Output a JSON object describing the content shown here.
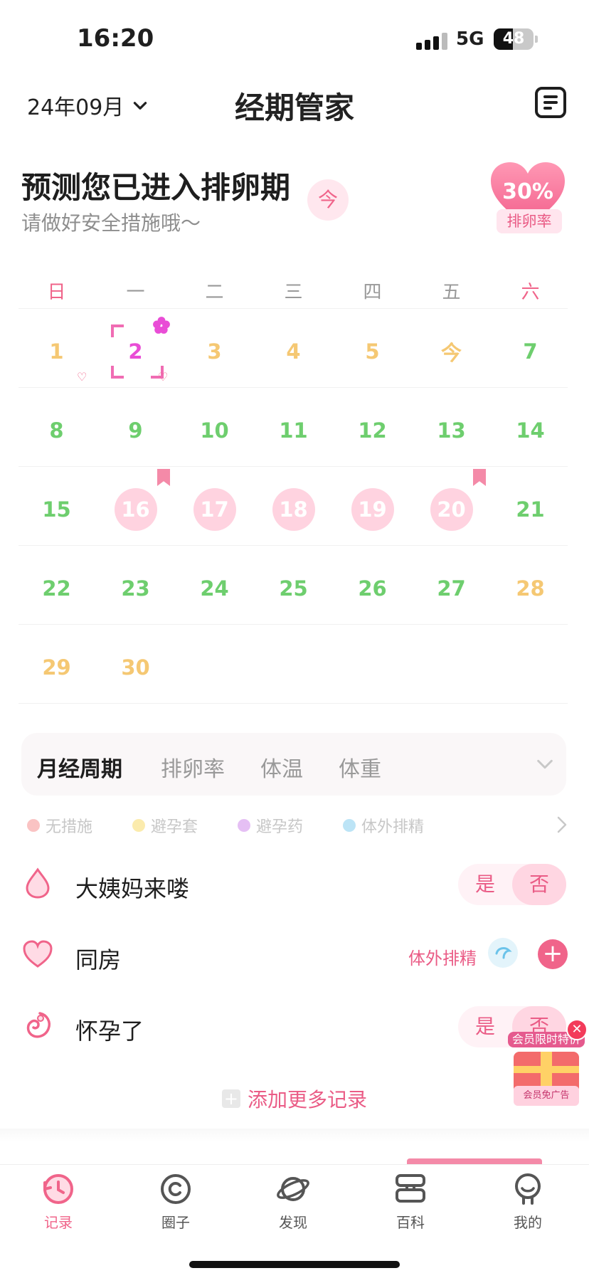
{
  "status_bar": {
    "time": "16:20",
    "network": "5G",
    "battery": "48",
    "battery_level": 0.48
  },
  "header": {
    "month": "24年09月",
    "title": "经期管家"
  },
  "prediction": {
    "title": "预测您已进入排卵期",
    "subtitle": "请做好安全措施哦～",
    "today_chip": "今",
    "ovulation_rate": "30%",
    "ovulation_rate_label": "排卵率"
  },
  "calendar": {
    "weekdays": [
      "日",
      "一",
      "二",
      "三",
      "四",
      "五",
      "六"
    ],
    "rows": [
      [
        "1",
        "2",
        "3",
        "4",
        "5",
        "今",
        "7"
      ],
      [
        "8",
        "9",
        "10",
        "11",
        "12",
        "13",
        "14"
      ],
      [
        "15",
        "16",
        "17",
        "18",
        "19",
        "20",
        "21"
      ],
      [
        "22",
        "23",
        "24",
        "25",
        "26",
        "27",
        "28"
      ],
      [
        "29",
        "30",
        "",
        "",
        "",
        "",
        ""
      ]
    ],
    "heart_marker": "♡"
  },
  "tabs": [
    "月经周期",
    "排卵率",
    "体温",
    "体重"
  ],
  "legend": [
    "无措施",
    "避孕套",
    "避孕药",
    "体外排精"
  ],
  "colors": {
    "accent": "#f0648a",
    "fertile_circle": "#ffd3e0",
    "safe_green": "#6ece6e",
    "period_yellow": "#f5c873",
    "legend_dots": [
      "#f47a7a",
      "#f7d34a",
      "#c572e6",
      "#6bc3ea"
    ]
  },
  "records": {
    "period": {
      "label": "大姨妈来喽",
      "yes": "是",
      "no": "否",
      "icon": "droplet-icon"
    },
    "sex": {
      "label": "同房",
      "value": "体外排精",
      "icon": "heart-icon",
      "add": "+"
    },
    "pregnant": {
      "label": "怀孕了",
      "yes": "是",
      "no": "否",
      "icon": "fetus-icon"
    }
  },
  "add_more": {
    "plus": "+",
    "label": "添加更多记录"
  },
  "ad": {
    "top": "会员限时特价",
    "bottom": "会员免广告",
    "close": "✕"
  },
  "nav": [
    {
      "label": "记录",
      "icon": "clock-history-icon"
    },
    {
      "label": "圈子",
      "icon": "circle-icon"
    },
    {
      "label": "发现",
      "icon": "planet-icon"
    },
    {
      "label": "百科",
      "icon": "encyclopedia-icon"
    },
    {
      "label": "我的",
      "icon": "profile-icon"
    }
  ]
}
